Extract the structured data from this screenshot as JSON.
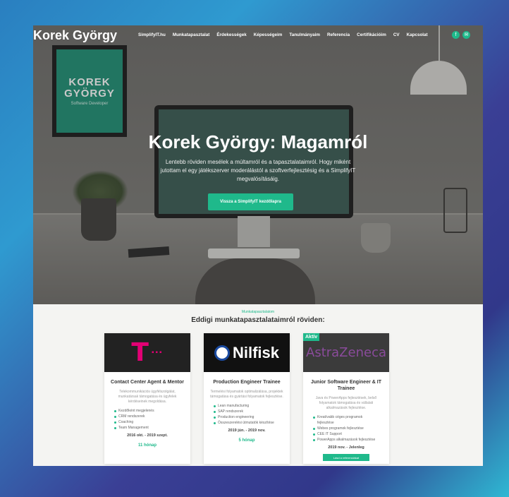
{
  "brand": "Korek György",
  "nav": [
    "SimplifyIT.hu",
    "Munkatapasztalat",
    "Érdekességek",
    "Képességeim",
    "Tanulmányaim",
    "Referencia",
    "Certifikációim",
    "CV",
    "Kapcsolat"
  ],
  "social": {
    "facebook": "f",
    "email": "✉"
  },
  "poster": {
    "line1": "KOREK",
    "line2": "GYÖRGY",
    "tag": "Software Developer"
  },
  "hero": {
    "title": "Korek György: Magamról",
    "subtitle": "Lentebb röviden mesélek a múltamról és a tapasztalataimról. Hogy miként jutottam el egy játékszerver moderálástól a szoftverfejlesztésig és a SimplifyIT megvalósításáig.",
    "button": "Vissza a SimplifyIT kezdőlapra"
  },
  "section": {
    "kicker": "Munkatapasztalatom",
    "title": "Eddigi munkatapasztalataimról röviden:"
  },
  "cards": [
    {
      "logo": "T",
      "role": "Contact Center Agent & Mentor",
      "desc": "Telekommunikációs ügyfélszolgálat, munkatársak támogatása és ügyfelek kérdéseinek megoldása.",
      "items": [
        "Kezdőként megjelenés",
        "CRM rendszerek",
        "Coaching",
        "Team Management"
      ],
      "date": "2016 okt. - 2019 szept.",
      "duration": "11 hónap"
    },
    {
      "logo": "Nilfisk",
      "role": "Production Engineer Trainee",
      "desc": "Termelési folyamatok optimalizálása, projektek támogatása és gyártási folyamatok fejlesztése.",
      "items": [
        "Lean manufacturing",
        "SAP rendszerek",
        "Production engineering",
        "Összeszerelési útmutatók készítése"
      ],
      "date": "2019 jún. - 2019 nov.",
      "duration": "5 hónap"
    },
    {
      "badge": "Aktív",
      "logo": "AstraZeneca",
      "role": "Junior Software Engineer & IT Trainee",
      "desc": "Java és PowerApps fejlesztések, belső folyamatok támogatása és vállalati alkalmazások fejlesztése.",
      "items": [
        "Kreatívabb céges programok fejlesztése",
        "Webes programok fejlesztése",
        "CEE IT Support",
        "PowerApps alkalmazások fejlesztése"
      ],
      "date": "2019 nov. - Jelenleg",
      "cta": "Lásd a referenciákat"
    }
  ]
}
